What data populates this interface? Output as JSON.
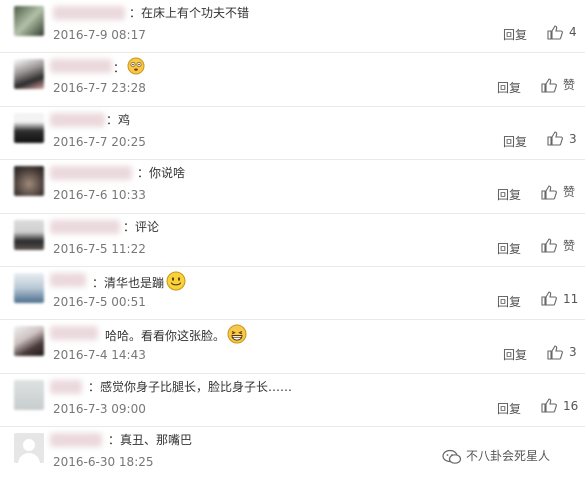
{
  "reply_label": "回复",
  "comments": [
    {
      "text": "：在床上有个功夫不错",
      "date": "2016-7-9 08:17",
      "likes": "4",
      "emoji": ""
    },
    {
      "text": "：",
      "date": "2016-7-7 23:28",
      "likes": "赞",
      "emoji": "dizzy-face"
    },
    {
      "text": "：鸡",
      "date": "2016-7-7 20:25",
      "likes": "3",
      "emoji": ""
    },
    {
      "text": "：你说啥",
      "date": "2016-7-6 10:33",
      "likes": "赞",
      "emoji": ""
    },
    {
      "text": "：评论",
      "date": "2016-7-5 11:22",
      "likes": "赞",
      "emoji": ""
    },
    {
      "text": "：清华也是蹦",
      "date": "2016-7-5 00:51",
      "likes": "11",
      "emoji": "smile-face"
    },
    {
      "text": "哈哈。看看你这张脸。",
      "date": "2016-7-4 14:43",
      "likes": "3",
      "emoji": "laugh-face"
    },
    {
      "text": "：感觉你身子比腿长，脸比身子长……",
      "date": "2016-7-3 09:00",
      "likes": "16",
      "emoji": ""
    },
    {
      "text": "：真丑、那嘴巴",
      "date": "2016-6-30 18:25",
      "likes": "",
      "emoji": ""
    }
  ],
  "watermark": {
    "text": "不八卦会死星人"
  },
  "colors": {
    "date": "#777777",
    "divider": "#e9e9e9",
    "name_blur": "#ead8dc"
  }
}
